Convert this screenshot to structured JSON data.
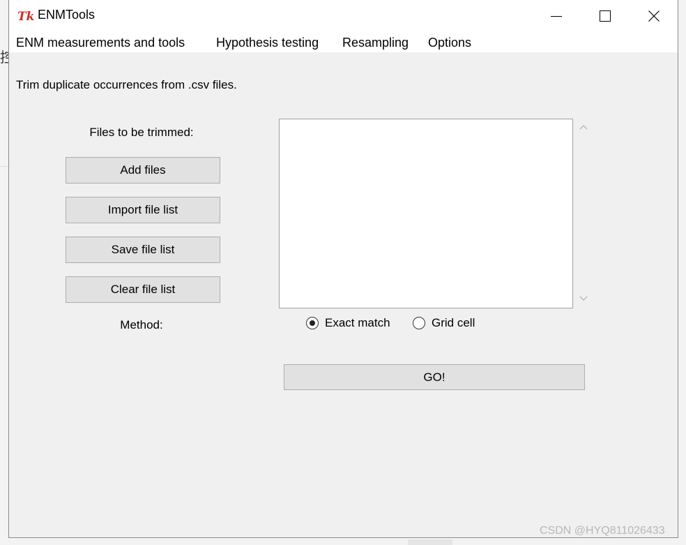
{
  "window": {
    "title": "ENMTools",
    "logo_text": "Tk"
  },
  "menubar": {
    "items": [
      {
        "label": "ENM measurements and tools"
      },
      {
        "label": "Hypothesis testing"
      },
      {
        "label": "Resampling"
      },
      {
        "label": "Options"
      }
    ]
  },
  "panel": {
    "description": "Trim duplicate occurrences from .csv files.",
    "files_label": "Files to be trimmed:",
    "buttons": {
      "add_files": "Add files",
      "import_list": "Import file list",
      "save_list": "Save file list",
      "clear_list": "Clear file list"
    },
    "method_label": "Method:",
    "method_options": [
      {
        "label": "Exact match",
        "selected": true
      },
      {
        "label": "Grid cell",
        "selected": false
      }
    ],
    "go_label": "GO!"
  },
  "background": {
    "left_glyph": "控",
    "right_glyph": "!",
    "watermark": "CSDN @HYQ811026433"
  },
  "colors": {
    "logo_red": "#d42a20",
    "button_face": "#e1e1e1",
    "window_bg": "#f0f0f0"
  }
}
